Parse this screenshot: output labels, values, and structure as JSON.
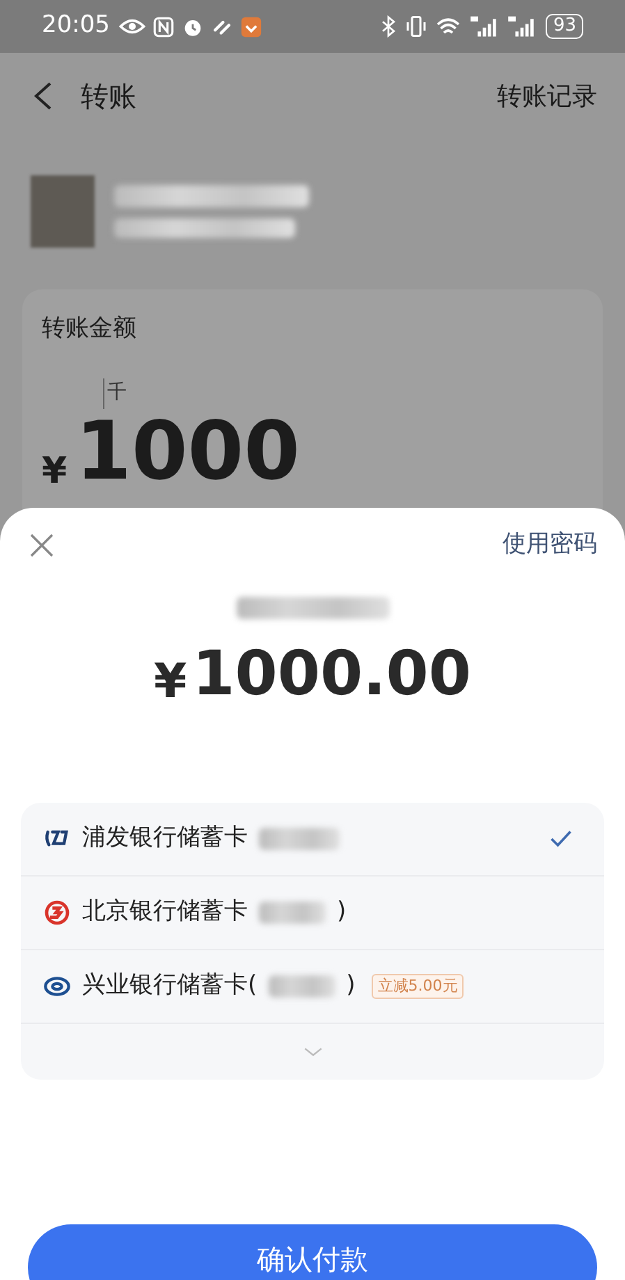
{
  "status_bar": {
    "time": "20:05",
    "battery": "93"
  },
  "header": {
    "title": "转账",
    "action": "转账记录"
  },
  "amount_card": {
    "label": "转账金额",
    "unit_hint": "千",
    "currency": "¥",
    "amount": "1000"
  },
  "sheet": {
    "action": "使用密码",
    "currency": "¥",
    "amount": "1000.00",
    "cards": [
      {
        "name": "浦发银行储蓄卡",
        "color": "#1f3f73",
        "selected": true
      },
      {
        "name": "北京银行储蓄卡",
        "suffix": ")",
        "color": "#d9342b",
        "selected": false
      },
      {
        "name": "兴业银行储蓄卡(",
        "suffix": ")",
        "color": "#1d4f91",
        "selected": false,
        "tag": "立减5.00元"
      }
    ],
    "confirm": "确认付款"
  }
}
